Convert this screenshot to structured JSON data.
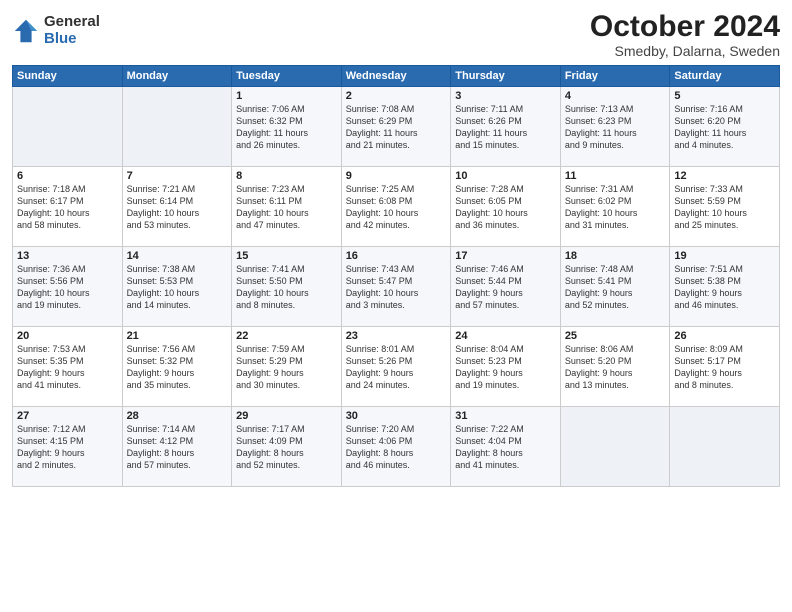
{
  "logo": {
    "general": "General",
    "blue": "Blue"
  },
  "title": {
    "month": "October 2024",
    "location": "Smedby, Dalarna, Sweden"
  },
  "headers": [
    "Sunday",
    "Monday",
    "Tuesday",
    "Wednesday",
    "Thursday",
    "Friday",
    "Saturday"
  ],
  "weeks": [
    [
      {
        "day": "",
        "detail": ""
      },
      {
        "day": "",
        "detail": ""
      },
      {
        "day": "1",
        "detail": "Sunrise: 7:06 AM\nSunset: 6:32 PM\nDaylight: 11 hours\nand 26 minutes."
      },
      {
        "day": "2",
        "detail": "Sunrise: 7:08 AM\nSunset: 6:29 PM\nDaylight: 11 hours\nand 21 minutes."
      },
      {
        "day": "3",
        "detail": "Sunrise: 7:11 AM\nSunset: 6:26 PM\nDaylight: 11 hours\nand 15 minutes."
      },
      {
        "day": "4",
        "detail": "Sunrise: 7:13 AM\nSunset: 6:23 PM\nDaylight: 11 hours\nand 9 minutes."
      },
      {
        "day": "5",
        "detail": "Sunrise: 7:16 AM\nSunset: 6:20 PM\nDaylight: 11 hours\nand 4 minutes."
      }
    ],
    [
      {
        "day": "6",
        "detail": "Sunrise: 7:18 AM\nSunset: 6:17 PM\nDaylight: 10 hours\nand 58 minutes."
      },
      {
        "day": "7",
        "detail": "Sunrise: 7:21 AM\nSunset: 6:14 PM\nDaylight: 10 hours\nand 53 minutes."
      },
      {
        "day": "8",
        "detail": "Sunrise: 7:23 AM\nSunset: 6:11 PM\nDaylight: 10 hours\nand 47 minutes."
      },
      {
        "day": "9",
        "detail": "Sunrise: 7:25 AM\nSunset: 6:08 PM\nDaylight: 10 hours\nand 42 minutes."
      },
      {
        "day": "10",
        "detail": "Sunrise: 7:28 AM\nSunset: 6:05 PM\nDaylight: 10 hours\nand 36 minutes."
      },
      {
        "day": "11",
        "detail": "Sunrise: 7:31 AM\nSunset: 6:02 PM\nDaylight: 10 hours\nand 31 minutes."
      },
      {
        "day": "12",
        "detail": "Sunrise: 7:33 AM\nSunset: 5:59 PM\nDaylight: 10 hours\nand 25 minutes."
      }
    ],
    [
      {
        "day": "13",
        "detail": "Sunrise: 7:36 AM\nSunset: 5:56 PM\nDaylight: 10 hours\nand 19 minutes."
      },
      {
        "day": "14",
        "detail": "Sunrise: 7:38 AM\nSunset: 5:53 PM\nDaylight: 10 hours\nand 14 minutes."
      },
      {
        "day": "15",
        "detail": "Sunrise: 7:41 AM\nSunset: 5:50 PM\nDaylight: 10 hours\nand 8 minutes."
      },
      {
        "day": "16",
        "detail": "Sunrise: 7:43 AM\nSunset: 5:47 PM\nDaylight: 10 hours\nand 3 minutes."
      },
      {
        "day": "17",
        "detail": "Sunrise: 7:46 AM\nSunset: 5:44 PM\nDaylight: 9 hours\nand 57 minutes."
      },
      {
        "day": "18",
        "detail": "Sunrise: 7:48 AM\nSunset: 5:41 PM\nDaylight: 9 hours\nand 52 minutes."
      },
      {
        "day": "19",
        "detail": "Sunrise: 7:51 AM\nSunset: 5:38 PM\nDaylight: 9 hours\nand 46 minutes."
      }
    ],
    [
      {
        "day": "20",
        "detail": "Sunrise: 7:53 AM\nSunset: 5:35 PM\nDaylight: 9 hours\nand 41 minutes."
      },
      {
        "day": "21",
        "detail": "Sunrise: 7:56 AM\nSunset: 5:32 PM\nDaylight: 9 hours\nand 35 minutes."
      },
      {
        "day": "22",
        "detail": "Sunrise: 7:59 AM\nSunset: 5:29 PM\nDaylight: 9 hours\nand 30 minutes."
      },
      {
        "day": "23",
        "detail": "Sunrise: 8:01 AM\nSunset: 5:26 PM\nDaylight: 9 hours\nand 24 minutes."
      },
      {
        "day": "24",
        "detail": "Sunrise: 8:04 AM\nSunset: 5:23 PM\nDaylight: 9 hours\nand 19 minutes."
      },
      {
        "day": "25",
        "detail": "Sunrise: 8:06 AM\nSunset: 5:20 PM\nDaylight: 9 hours\nand 13 minutes."
      },
      {
        "day": "26",
        "detail": "Sunrise: 8:09 AM\nSunset: 5:17 PM\nDaylight: 9 hours\nand 8 minutes."
      }
    ],
    [
      {
        "day": "27",
        "detail": "Sunrise: 7:12 AM\nSunset: 4:15 PM\nDaylight: 9 hours\nand 2 minutes."
      },
      {
        "day": "28",
        "detail": "Sunrise: 7:14 AM\nSunset: 4:12 PM\nDaylight: 8 hours\nand 57 minutes."
      },
      {
        "day": "29",
        "detail": "Sunrise: 7:17 AM\nSunset: 4:09 PM\nDaylight: 8 hours\nand 52 minutes."
      },
      {
        "day": "30",
        "detail": "Sunrise: 7:20 AM\nSunset: 4:06 PM\nDaylight: 8 hours\nand 46 minutes."
      },
      {
        "day": "31",
        "detail": "Sunrise: 7:22 AM\nSunset: 4:04 PM\nDaylight: 8 hours\nand 41 minutes."
      },
      {
        "day": "",
        "detail": ""
      },
      {
        "day": "",
        "detail": ""
      }
    ]
  ]
}
